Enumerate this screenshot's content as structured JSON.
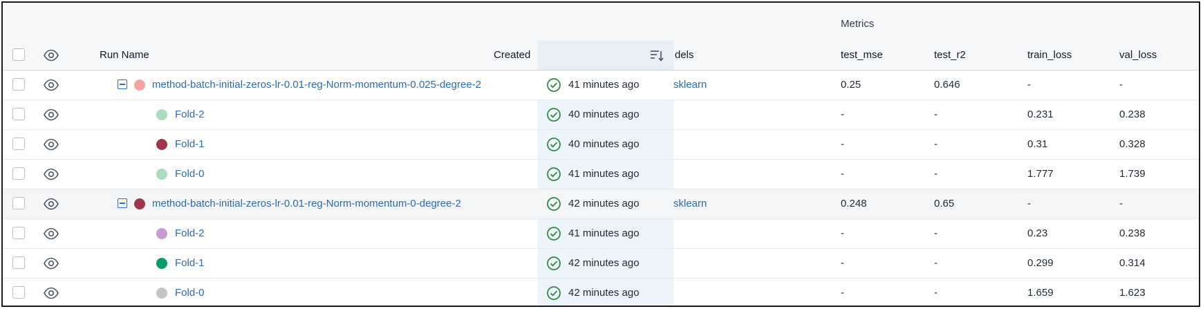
{
  "header": {
    "group_label": "Metrics",
    "columns": {
      "run_name": "Run Name",
      "created": "Created",
      "models": "dels",
      "test_mse": "test_mse",
      "test_r2": "test_r2",
      "train_loss": "train_loss",
      "val_loss": "val_loss"
    }
  },
  "rows": [
    {
      "name": "method-batch-initial-zeros-lr-0.01-reg-Norm-momentum-0.025-degree-2",
      "created": "41 minutes ago",
      "models": "sklearn",
      "test_mse": "0.25",
      "test_r2": "0.646",
      "train_loss": "-",
      "val_loss": "-",
      "color": "#f4a3a3"
    },
    {
      "name": "Fold-2",
      "created": "40 minutes ago",
      "models": "",
      "test_mse": "-",
      "test_r2": "-",
      "train_loss": "0.231",
      "val_loss": "0.238",
      "color": "#a8dcbc"
    },
    {
      "name": "Fold-1",
      "created": "40 minutes ago",
      "models": "",
      "test_mse": "-",
      "test_r2": "-",
      "train_loss": "0.31",
      "val_loss": "0.328",
      "color": "#a3344d"
    },
    {
      "name": "Fold-0",
      "created": "41 minutes ago",
      "models": "",
      "test_mse": "-",
      "test_r2": "-",
      "train_loss": "1.777",
      "val_loss": "1.739",
      "color": "#a8dcbc"
    },
    {
      "name": "method-batch-initial-zeros-lr-0.01-reg-Norm-momentum-0-degree-2",
      "created": "42 minutes ago",
      "models": "sklearn",
      "test_mse": "0.248",
      "test_r2": "0.65",
      "train_loss": "-",
      "val_loss": "-",
      "color": "#a3344d"
    },
    {
      "name": "Fold-2",
      "created": "41 minutes ago",
      "models": "",
      "test_mse": "-",
      "test_r2": "-",
      "train_loss": "0.23",
      "val_loss": "0.238",
      "color": "#c79bd1"
    },
    {
      "name": "Fold-1",
      "created": "42 minutes ago",
      "models": "",
      "test_mse": "-",
      "test_r2": "-",
      "train_loss": "0.299",
      "val_loss": "0.314",
      "color": "#0a9b6a"
    },
    {
      "name": "Fold-0",
      "created": "42 minutes ago",
      "models": "",
      "test_mse": "-",
      "test_r2": "-",
      "train_loss": "1.659",
      "val_loss": "1.623",
      "color": "#c4c4c4"
    }
  ],
  "status_icon": "check-circle-icon",
  "accent_color": "#2b6cb0"
}
